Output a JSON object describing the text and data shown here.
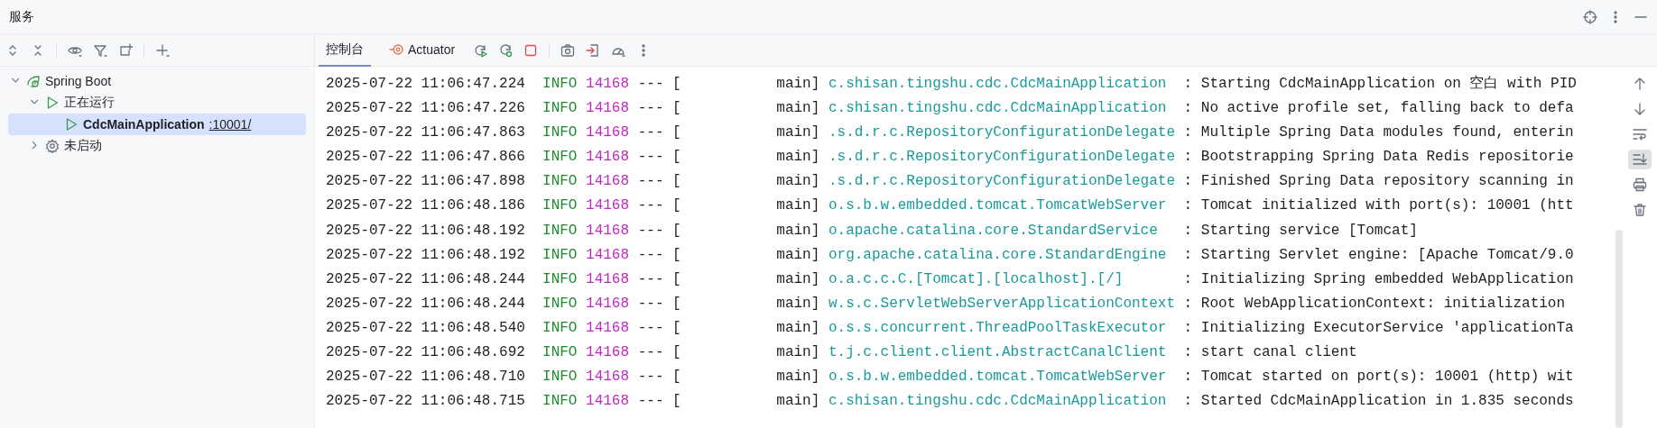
{
  "window": {
    "title": "服务"
  },
  "tree": [
    {
      "label": "Spring Boot",
      "kind": "framework",
      "expanded": true,
      "selected": false,
      "children": [
        {
          "label": "正在运行",
          "kind": "running",
          "expanded": true,
          "selected": false,
          "children": [
            {
              "label": "CdcMainApplication",
              "link": ":10001/",
              "kind": "app",
              "selected": true
            }
          ]
        },
        {
          "label": "未启动",
          "kind": "idle",
          "expanded": false,
          "selected": false
        }
      ]
    }
  ],
  "tabs": [
    {
      "label": "控制台",
      "kind": "console",
      "selected": true
    },
    {
      "label": "Actuator",
      "kind": "actuator",
      "selected": false
    }
  ],
  "side_tools": [
    {
      "kind": "up",
      "selected": false
    },
    {
      "kind": "down",
      "selected": false
    },
    {
      "kind": "wrap",
      "selected": false
    },
    {
      "kind": "scroll_end",
      "selected": true
    },
    {
      "kind": "print",
      "selected": false
    },
    {
      "kind": "clear",
      "selected": false
    }
  ],
  "log": [
    {
      "time": "2025-07-22 11:06:47.224",
      "level": "INFO",
      "pid": "14168",
      "sep": "---",
      "thread": "[           main]",
      "logger": "c.shisan.tingshu.cdc.CdcMainApplication",
      "message": ": Starting CdcMainApplication on 空白 with PID"
    },
    {
      "time": "2025-07-22 11:06:47.226",
      "level": "INFO",
      "pid": "14168",
      "sep": "---",
      "thread": "[           main]",
      "logger": "c.shisan.tingshu.cdc.CdcMainApplication",
      "message": ": No active profile set, falling back to defa"
    },
    {
      "time": "2025-07-22 11:06:47.863",
      "level": "INFO",
      "pid": "14168",
      "sep": "---",
      "thread": "[           main]",
      "logger": ".s.d.r.c.RepositoryConfigurationDelegate",
      "message": ": Multiple Spring Data modules found, enterin"
    },
    {
      "time": "2025-07-22 11:06:47.866",
      "level": "INFO",
      "pid": "14168",
      "sep": "---",
      "thread": "[           main]",
      "logger": ".s.d.r.c.RepositoryConfigurationDelegate",
      "message": ": Bootstrapping Spring Data Redis repositorie"
    },
    {
      "time": "2025-07-22 11:06:47.898",
      "level": "INFO",
      "pid": "14168",
      "sep": "---",
      "thread": "[           main]",
      "logger": ".s.d.r.c.RepositoryConfigurationDelegate",
      "message": ": Finished Spring Data repository scanning in"
    },
    {
      "time": "2025-07-22 11:06:48.186",
      "level": "INFO",
      "pid": "14168",
      "sep": "---",
      "thread": "[           main]",
      "logger": "o.s.b.w.embedded.tomcat.TomcatWebServer",
      "message": ": Tomcat initialized with port(s): 10001 (htt"
    },
    {
      "time": "2025-07-22 11:06:48.192",
      "level": "INFO",
      "pid": "14168",
      "sep": "---",
      "thread": "[           main]",
      "logger": "o.apache.catalina.core.StandardService",
      "message": ": Starting service [Tomcat]"
    },
    {
      "time": "2025-07-22 11:06:48.192",
      "level": "INFO",
      "pid": "14168",
      "sep": "---",
      "thread": "[           main]",
      "logger": "org.apache.catalina.core.StandardEngine",
      "message": ": Starting Servlet engine: [Apache Tomcat/9.0"
    },
    {
      "time": "2025-07-22 11:06:48.244",
      "level": "INFO",
      "pid": "14168",
      "sep": "---",
      "thread": "[           main]",
      "logger": "o.a.c.c.C.[Tomcat].[localhost].[/]",
      "message": ": Initializing Spring embedded WebApplication"
    },
    {
      "time": "2025-07-22 11:06:48.244",
      "level": "INFO",
      "pid": "14168",
      "sep": "---",
      "thread": "[           main]",
      "logger": "w.s.c.ServletWebServerApplicationContext",
      "message": ": Root WebApplicationContext: initialization"
    },
    {
      "time": "2025-07-22 11:06:48.540",
      "level": "INFO",
      "pid": "14168",
      "sep": "---",
      "thread": "[           main]",
      "logger": "o.s.s.concurrent.ThreadPoolTaskExecutor",
      "message": ": Initializing ExecutorService 'applicationTa"
    },
    {
      "time": "2025-07-22 11:06:48.692",
      "level": "INFO",
      "pid": "14168",
      "sep": "---",
      "thread": "[           main]",
      "logger": "t.j.c.client.client.AbstractCanalClient",
      "message": ": start canal client"
    },
    {
      "time": "2025-07-22 11:06:48.710",
      "level": "INFO",
      "pid": "14168",
      "sep": "---",
      "thread": "[           main]",
      "logger": "o.s.b.w.embedded.tomcat.TomcatWebServer",
      "message": ": Tomcat started on port(s): 10001 (http) wit"
    },
    {
      "time": "2025-07-22 11:06:48.715",
      "level": "INFO",
      "pid": "14168",
      "sep": "---",
      "thread": "[           main]",
      "logger": "c.shisan.tingshu.cdc.CdcMainApplication",
      "message": ": Started CdcMainApplication in 1.835 seconds"
    }
  ]
}
